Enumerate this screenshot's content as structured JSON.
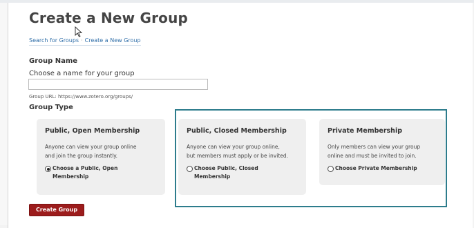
{
  "page": {
    "title": "Create a New Group",
    "breadcrumb": [
      "Search for Groups",
      "Create a New Group"
    ],
    "breadcrumb_separator": "·"
  },
  "group_name": {
    "section_label": "Group Name",
    "field_label": "Choose a name for your group",
    "value": "",
    "placeholder": "",
    "url_hint": "Group URL: https://www.zotero.org/groups/"
  },
  "group_type": {
    "section_label": "Group Type",
    "options": [
      {
        "title": "Public, Open Membership",
        "desc_line1": "Anyone can view your group online",
        "desc_line2": "and join the group instantly.",
        "choice_line1": "Choose a Public, Open",
        "choice_line2": "Membership",
        "selected": true
      },
      {
        "title": "Public, Closed Membership",
        "desc_line1": "Anyone can view your group online,",
        "desc_line2": "but members must apply or be invited.",
        "choice_line1": "Choose Public, Closed",
        "choice_line2": "Membership",
        "selected": false
      },
      {
        "title": "Private Membership",
        "desc_line1": "Only members can view your group",
        "desc_line2": "online and must be invited to join.",
        "choice_line1": "Choose Private Membership",
        "choice_line2": "",
        "selected": false
      }
    ]
  },
  "actions": {
    "create_label": "Create Group"
  },
  "colors": {
    "accent_red": "#9c1c1c",
    "link_blue": "#2f6ea8",
    "highlight_teal": "#2d7c8c",
    "card_bg": "#efefef"
  }
}
